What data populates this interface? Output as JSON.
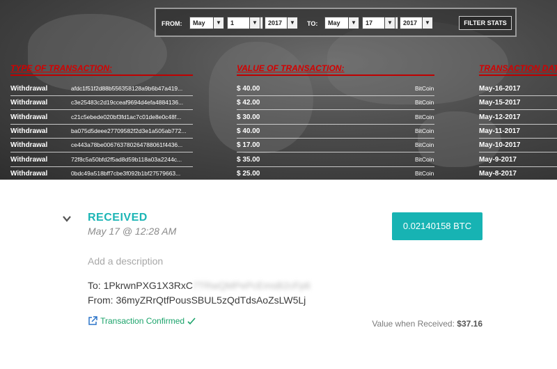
{
  "filter": {
    "from_label": "FROM:",
    "to_label": "TO:",
    "from": {
      "month": "May",
      "day": "1",
      "year": "2017"
    },
    "to": {
      "month": "May",
      "day": "17",
      "year": "2017"
    },
    "button_label": "FILTER STATS"
  },
  "table": {
    "headers": [
      "TYPE OF TRANSACTION:",
      "VALUE OF TRANSACTION:",
      "TRANSACTION DATE"
    ],
    "rows": [
      {
        "type": "Withdrawal",
        "hash": "afdc1f51f2d88b556358128a9b6b47a419...",
        "value": "$ 40.00",
        "currency": "BitCoin",
        "date": "May-16-2017"
      },
      {
        "type": "Withdrawal",
        "hash": "c3e25483c2d19cceaf9694d4efa4884136...",
        "value": "$ 42.00",
        "currency": "BitCoin",
        "date": "May-15-2017"
      },
      {
        "type": "Withdrawal",
        "hash": "c21c5ebede020bf3fd1ac7c01de8e0c48f...",
        "value": "$ 30.00",
        "currency": "BitCoin",
        "date": "May-12-2017"
      },
      {
        "type": "Withdrawal",
        "hash": "ba075d5deee27709582f2d3e1a505ab772...",
        "value": "$ 40.00",
        "currency": "BitCoin",
        "date": "May-11-2017"
      },
      {
        "type": "Withdrawal",
        "hash": "ce443a78be006763780264788061f4436...",
        "value": "$ 17.00",
        "currency": "BitCoin",
        "date": "May-10-2017"
      },
      {
        "type": "Withdrawal",
        "hash": "72f8c5a50bfd2f5ad8d59b118a03a2244c...",
        "value": "$ 35.00",
        "currency": "BitCoin",
        "date": "May-9-2017"
      },
      {
        "type": "Withdrawal",
        "hash": "0bdc49a518bff7cbe3f092b1bf27579663...",
        "value": "$ 25.00",
        "currency": "BitCoin",
        "date": "May-8-2017"
      }
    ]
  },
  "transaction": {
    "status": "RECEIVED",
    "timestamp": "May 17 @ 12:28 AM",
    "amount": "0.02140158 BTC",
    "description_placeholder": "Add a description",
    "to_label": "To:",
    "to_address_visible": "1PkrwnPXG1X3RxC",
    "to_address_blurred": "7TRwQMPePcEmsB2cFp6",
    "from_label": "From:",
    "from_address": "36myZRrQtfPousSBUL5zQdTdsAoZsLW5Lj",
    "confirmed_label": "Transaction Confirmed",
    "value_label": "Value when Received:",
    "value_amount": "$37.16"
  },
  "colors": {
    "teal": "#1bb5b5",
    "header_red": "#d40000",
    "confirmed_green": "#1aa36a"
  },
  "icons": [
    "chevron-down-icon",
    "external-link-icon",
    "checkmark-icon",
    "dropdown-arrow-icon"
  ]
}
